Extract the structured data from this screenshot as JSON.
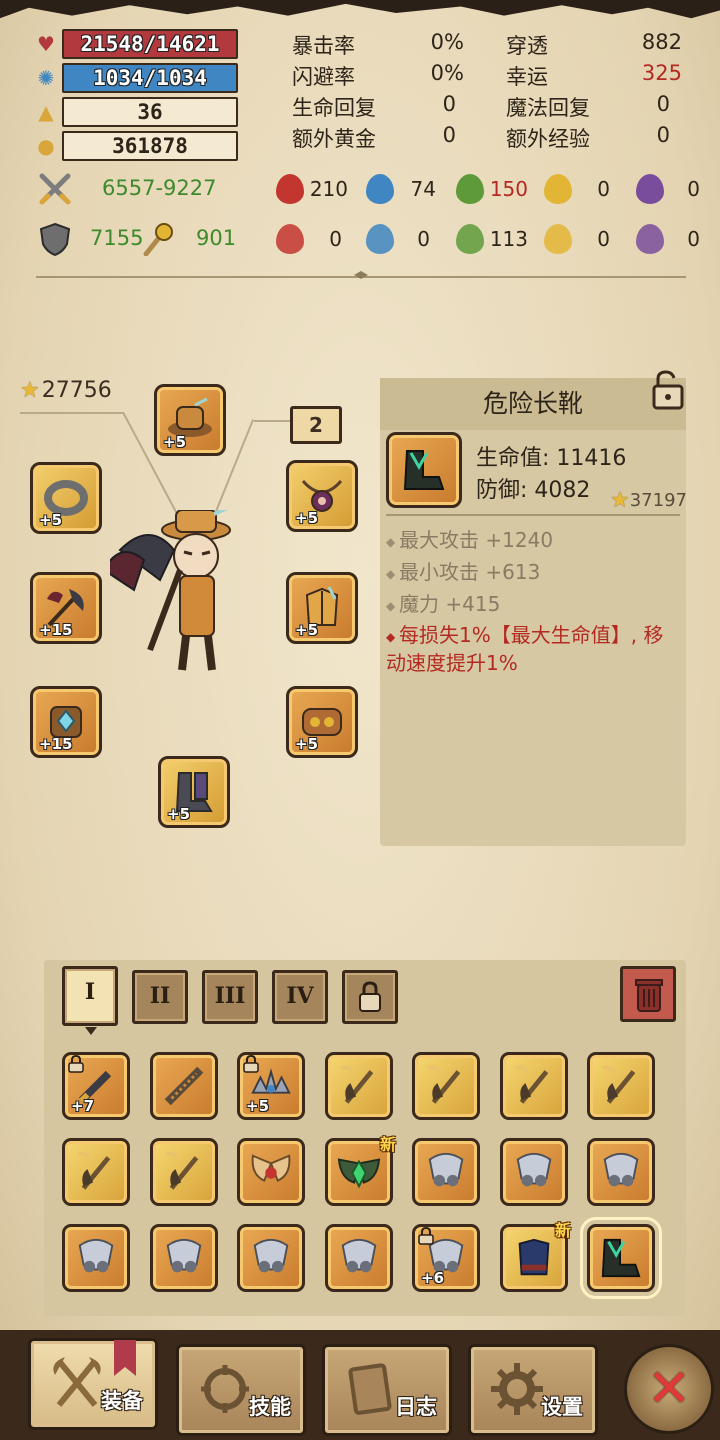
{
  "top_bars": {
    "hp": "21548/14621",
    "mp": "1034/1034",
    "level": "36",
    "gold": "361878"
  },
  "stats": [
    {
      "label": "暴击率",
      "value": "0%"
    },
    {
      "label": "闪避率",
      "value": "0%"
    },
    {
      "label": "生命回复",
      "value": "0"
    },
    {
      "label": "额外黄金",
      "value": "0"
    },
    {
      "label": "穿透",
      "value": "882"
    },
    {
      "label": "幸运",
      "value": "325"
    },
    {
      "label": "魔法回复",
      "value": "0"
    },
    {
      "label": "额外经验",
      "value": "0"
    }
  ],
  "attack": {
    "range": "6557-9227",
    "elements": [
      "210",
      "74",
      "150",
      "0",
      "0"
    ]
  },
  "defense": {
    "armor": "7155",
    "magic": "901",
    "elements": [
      "0",
      "0",
      "113",
      "0",
      "0"
    ]
  },
  "equipment": {
    "total_power": "27756",
    "slots": [
      {
        "name": "hat",
        "plus": "+5"
      },
      {
        "name": "ring",
        "plus": "+5"
      },
      {
        "name": "necklace",
        "plus": "+5"
      },
      {
        "name": "weapon",
        "plus": "+15"
      },
      {
        "name": "armor",
        "plus": "+5"
      },
      {
        "name": "offhand",
        "plus": "+15"
      },
      {
        "name": "belt",
        "plus": "+5"
      },
      {
        "name": "boots",
        "plus": "+5"
      }
    ],
    "badge_count": "2"
  },
  "detail": {
    "title": "危险长靴",
    "hp_line": "生命值: 11416",
    "def_line": "防御: 4082",
    "power": "37197",
    "bonuses": [
      "最大攻击 +1240",
      "最小攻击 +613",
      "魔力 +415"
    ],
    "special": "每损失1%【最大生命值】, 移动速度提升1%"
  },
  "inventory": {
    "tabs": [
      "I",
      "II",
      "III",
      "IV"
    ],
    "items": [
      {
        "plus": "+7",
        "locked": true,
        "kind": "sword"
      },
      {
        "plus": "",
        "locked": false,
        "kind": "chainsaw"
      },
      {
        "plus": "+5",
        "locked": true,
        "kind": "tiara"
      },
      {
        "plus": "",
        "locked": false,
        "kind": "placeholder"
      },
      {
        "plus": "",
        "locked": false,
        "kind": "placeholder"
      },
      {
        "plus": "",
        "locked": false,
        "kind": "placeholder"
      },
      {
        "plus": "",
        "locked": false,
        "kind": "placeholder"
      },
      {
        "plus": "",
        "locked": false,
        "kind": "placeholder"
      },
      {
        "plus": "",
        "locked": false,
        "kind": "placeholder"
      },
      {
        "plus": "",
        "locked": false,
        "kind": "wings"
      },
      {
        "plus": "",
        "locked": false,
        "kind": "gem-wings",
        "new": "新"
      },
      {
        "plus": "",
        "locked": false,
        "kind": "feathers"
      },
      {
        "plus": "",
        "locked": false,
        "kind": "feathers"
      },
      {
        "plus": "",
        "locked": false,
        "kind": "feathers"
      },
      {
        "plus": "",
        "locked": false,
        "kind": "feathers"
      },
      {
        "plus": "",
        "locked": false,
        "kind": "feathers"
      },
      {
        "plus": "",
        "locked": false,
        "kind": "feathers"
      },
      {
        "plus": "",
        "locked": false,
        "kind": "feathers"
      },
      {
        "plus": "+6",
        "locked": true,
        "kind": "feathers"
      },
      {
        "plus": "",
        "locked": false,
        "kind": "chest",
        "new": "新"
      },
      {
        "plus": "",
        "locked": false,
        "kind": "boots"
      }
    ]
  },
  "nav": {
    "equip": "装备",
    "skills": "技能",
    "log": "日志",
    "settings": "设置"
  },
  "colors": {
    "hp": "#b23a3e",
    "mp": "#3f86c2",
    "green": "#3d8a2c",
    "red": "#b32a22"
  }
}
